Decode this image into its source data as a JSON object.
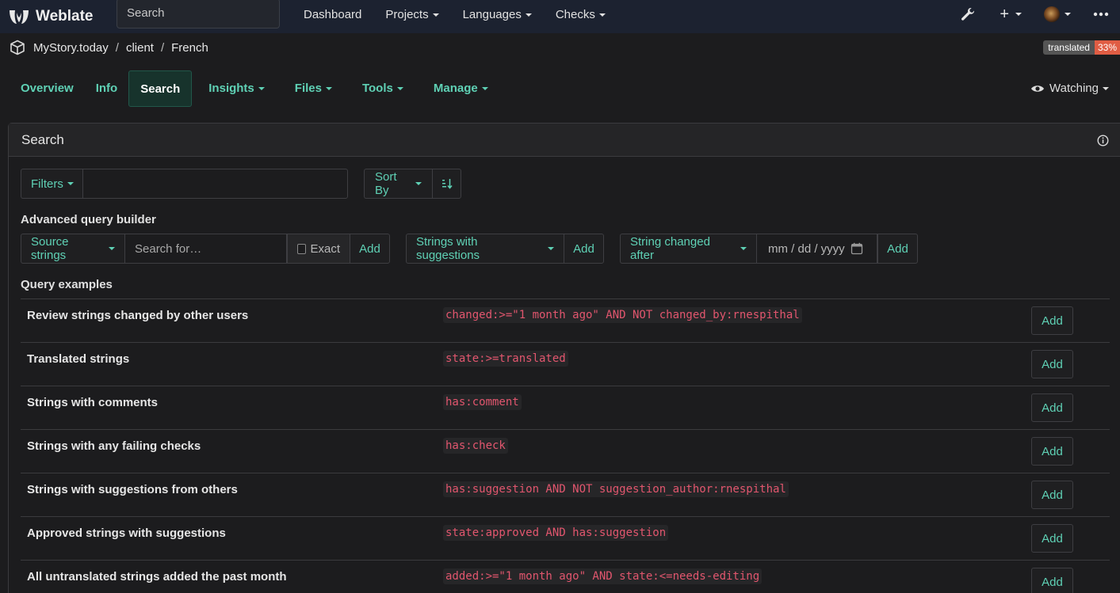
{
  "topbar": {
    "brand": "Weblate",
    "search_placeholder": "Search",
    "nav": [
      "Dashboard",
      "Projects",
      "Languages",
      "Checks"
    ]
  },
  "breadcrumb": {
    "project": "MyStory.today",
    "component": "client",
    "language": "French"
  },
  "badge": {
    "label": "translated",
    "value": "33%"
  },
  "tabs": [
    "Overview",
    "Info",
    "Search",
    "Insights",
    "Files",
    "Tools",
    "Manage"
  ],
  "watching": "Watching",
  "panel": {
    "title": "Search",
    "filters_label": "Filters",
    "query_value": "",
    "sort_label": "Sort By",
    "advanced_label": "Advanced query builder",
    "source_strings_label": "Source strings",
    "search_placeholder": "Search for…",
    "exact_label": "Exact",
    "add_label": "Add",
    "suggestions_label": "Strings with suggestions",
    "changed_after_label": "String changed after",
    "date_placeholder": "mm / dd / yyyy",
    "examples_label": "Query examples"
  },
  "examples": [
    {
      "title": "Review strings changed by other users",
      "query": "changed:>=\"1 month ago\" AND NOT changed_by:rnespithal",
      "add": "Add"
    },
    {
      "title": "Translated strings",
      "query": "state:>=translated",
      "add": "Add"
    },
    {
      "title": "Strings with comments",
      "query": "has:comment",
      "add": "Add"
    },
    {
      "title": "Strings with any failing checks",
      "query": "has:check",
      "add": "Add"
    },
    {
      "title": "Strings with suggestions from others",
      "query": "has:suggestion AND NOT suggestion_author:rnespithal",
      "add": "Add"
    },
    {
      "title": "Approved strings with suggestions",
      "query": "state:approved AND has:suggestion",
      "add": "Add"
    },
    {
      "title": "All untranslated strings added the past month",
      "query": "added:>=\"1 month ago\" AND state:<=needs-editing",
      "add": "Add"
    }
  ],
  "colors": {
    "accent": "#5fd1b5",
    "code": "#e2566e",
    "topbar": "#1c2230",
    "badge_value": "#e05d44"
  }
}
